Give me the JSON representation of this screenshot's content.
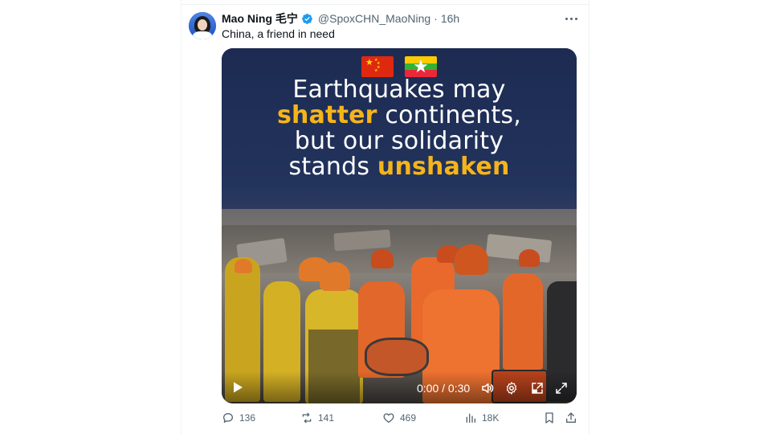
{
  "tweet": {
    "author_name": "Mao Ning 毛宁",
    "handle": "@SpoxCHN_MaoNing",
    "separator": "·",
    "time": "16h",
    "text": "China, a friend in need"
  },
  "media": {
    "headline_line1": "Earthquakes may",
    "headline_line2_highlight": "shatter",
    "headline_line2_rest": " continents,",
    "headline_line3": "but our solidarity",
    "headline_line4_rest": "stands ",
    "headline_line4_highlight": "unshaken",
    "timecode": "0:00 / 0:30",
    "highlight_color": "#f5b41a",
    "flags": [
      "china-flag",
      "myanmar-flag"
    ]
  },
  "actions": {
    "replies": "136",
    "reposts": "141",
    "likes": "469",
    "views": "18K"
  },
  "colors": {
    "text_primary": "#0f1419",
    "text_secondary": "#536471",
    "verified": "#1d9bf0"
  }
}
